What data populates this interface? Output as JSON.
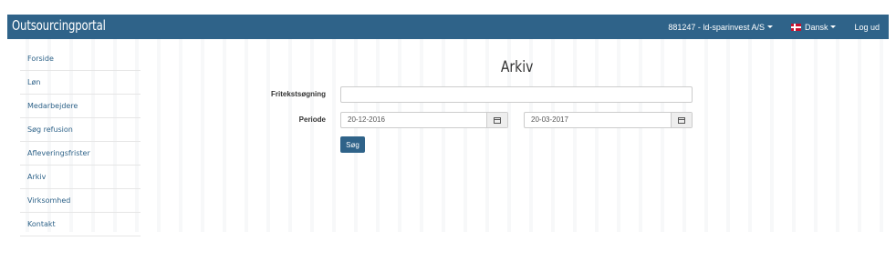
{
  "navbar": {
    "brand": "Outsourcingportal",
    "company": "881247 - ld-sparinvest A/S",
    "language": "Dansk",
    "logout": "Log ud"
  },
  "sidebar": {
    "items": [
      {
        "label": "Forside"
      },
      {
        "label": "Løn"
      },
      {
        "label": "Medarbejdere"
      },
      {
        "label": "Søg refusion"
      },
      {
        "label": "Afleveringsfrister"
      },
      {
        "label": "Arkiv"
      },
      {
        "label": "Virksomhed"
      },
      {
        "label": "Kontakt"
      }
    ]
  },
  "main": {
    "title": "Arkiv",
    "freetext_label": "Fritekstsøgning",
    "freetext_value": "",
    "period_label": "Periode",
    "date_from": "20-12-2016",
    "date_to": "20-03-2017",
    "search_button": "Søg"
  }
}
